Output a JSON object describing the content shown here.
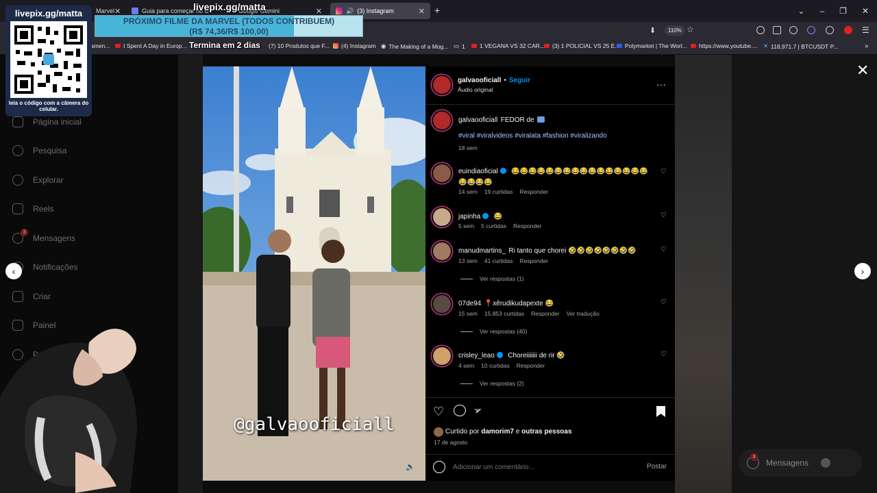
{
  "browser": {
    "tabs": [
      {
        "label": "Marvel",
        "active": false
      },
      {
        "label": "Guia para começar no Univers",
        "active": false
      },
      {
        "label": "Google Gemini",
        "active": false
      },
      {
        "label": "(3) Instagram",
        "active": true
      }
    ],
    "zoom": "110%",
    "bookmarks": [
      "amen...",
      "I Spent A Day in Europ...",
      "(7) 10 Produtos que F...",
      "(4) Instagram",
      "The Making of a Mog...",
      "1",
      "1 VEGANA VS 32 CAR...",
      "(3) 1 POLICIAL VS 25 E...",
      "Polymarket | The Worl...",
      "https://www.youtube....",
      "118,971.7 | BTCUSDT P..."
    ]
  },
  "stream_overlay": {
    "channel": "livepix.gg/matta",
    "qr_title": "livepix.gg/matta",
    "qr_caption": "leia o código com a câmera do celular.",
    "banner_title": "PRÓXIMO FILME DA MARVEL (TODOS CONTRIBUEM)",
    "banner_amount": "(R$ 74,36/R$ 100,00)",
    "banner_progress": 0.7436,
    "countdown": "Termina em 2 dias"
  },
  "sidebar": {
    "items": [
      {
        "label": "Página inicial",
        "icon": "home-icon"
      },
      {
        "label": "Pesquisa",
        "icon": "search-icon"
      },
      {
        "label": "Explorar",
        "icon": "compass-icon"
      },
      {
        "label": "Reels",
        "icon": "reels-icon"
      },
      {
        "label": "Mensagens",
        "icon": "messenger-icon"
      },
      {
        "label": "Notificações",
        "icon": "heart-icon"
      },
      {
        "label": "Criar",
        "icon": "plus-icon"
      },
      {
        "label": "Painel",
        "icon": "dashboard-icon"
      },
      {
        "label": "Perfil",
        "icon": "profile-icon"
      }
    ],
    "messages_badge": "3"
  },
  "post": {
    "watermark": "@galvaooficiall",
    "author": "galvaooficiall",
    "follow_label": "Seguir",
    "audio": "Áudio original",
    "caption_text": "FEDOR de",
    "caption_hashtags": "#viral #viralvideos #viralata #fashion #viralizando",
    "caption_time": "18 sem",
    "comments": [
      {
        "user": "euindiaoficial",
        "verified": true,
        "text": "😂😂😂😂😂😂😂😂😂😂😂😂😂😂😂😂😂😂😂😂",
        "time": "14 sem",
        "likes": "19 curtidas",
        "reply": "Responder"
      },
      {
        "user": "japinha",
        "verified": true,
        "text": "😂",
        "time": "5 sem",
        "likes": "5 curtidas",
        "reply": "Responder"
      },
      {
        "user": "manudmartins_",
        "verified": false,
        "text": "Ri tanto que chorei 🤣🤣🤣🤣🤣🤣🤣🤣",
        "time": "13 sem",
        "likes": "41 curtidas",
        "reply": "Responder",
        "view_replies": "Ver respostas (1)"
      },
      {
        "user": "07de94",
        "verified": false,
        "text": "📍xêrudikudapexte 😂",
        "time": "15 sem",
        "likes": "15.853 curtidas",
        "reply": "Responder",
        "translate": "Ver tradução",
        "view_replies": "Ver respostas (40)"
      },
      {
        "user": "crisley_leao",
        "verified": true,
        "text": "Choreiiiiiii de rir 🤣",
        "time": "4 sem",
        "likes": "10 curtidas",
        "reply": "Responder",
        "view_replies": "Ver respostas (2)"
      }
    ],
    "liked_by_prefix": "Curtido por",
    "liked_by_user": "damorim7",
    "liked_by_suffix": "e",
    "liked_by_others": "outras pessoas",
    "date": "17 de agosto",
    "comment_placeholder": "Adicionar um comentário...",
    "post_button": "Postar"
  },
  "floating_messages": "Mensagens",
  "floating_messages_badge": "3"
}
